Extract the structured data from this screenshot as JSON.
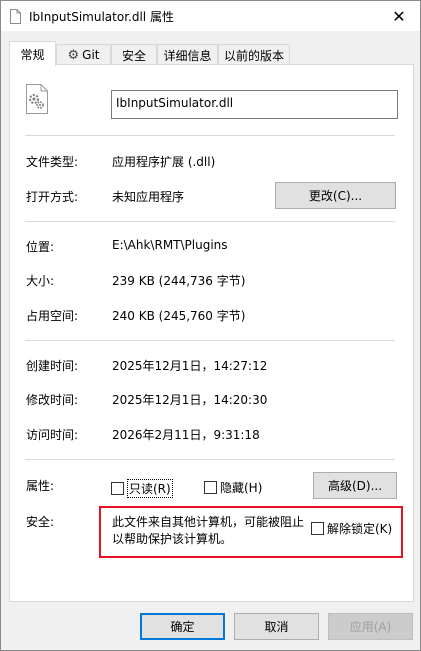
{
  "window": {
    "title": "IbInputSimulator.dll 属性",
    "close_symbol": "✕"
  },
  "tabs": [
    {
      "label": "常规",
      "active": true
    },
    {
      "label": "Git",
      "active": false
    },
    {
      "label": "安全",
      "active": false
    },
    {
      "label": "详细信息",
      "active": false
    },
    {
      "label": "以前的版本",
      "active": false
    }
  ],
  "file": {
    "name": "IbInputSimulator.dll",
    "icon": "dll-file-gear-icon"
  },
  "fields": {
    "type_label": "文件类型:",
    "type_value": "应用程序扩展 (.dll)",
    "open_label": "打开方式:",
    "open_value": "未知应用程序",
    "change_button": "更改(C)...",
    "location_label": "位置:",
    "location_value": "E:\\Ahk\\RMT\\Plugins",
    "size_label": "大小:",
    "size_value": "239 KB (244,736 字节)",
    "disk_label": "占用空间:",
    "disk_value": "240 KB (245,760 字节)",
    "created_label": "创建时间:",
    "created_value": "2025年12月1日，14:27:12",
    "modified_label": "修改时间:",
    "modified_value": "2025年12月1日，14:20:30",
    "accessed_label": "访问时间:",
    "accessed_value": "2026年2月11日，9:31:18",
    "attr_label": "属性:",
    "readonly_label": "只读(R)",
    "hidden_label": "隐藏(H)",
    "advanced_button": "高级(D)...",
    "security_label": "安全:",
    "security_text_1": "此文件来自其他计算机，可能被阻止",
    "security_text_2": "以帮助保护该计算机。",
    "unblock_label": "解除锁定(K)"
  },
  "buttons": {
    "ok": "确定",
    "cancel": "取消",
    "apply": "应用(A)"
  },
  "colors": {
    "highlight_border": "#e81123",
    "default_button_border": "#0078d7"
  }
}
